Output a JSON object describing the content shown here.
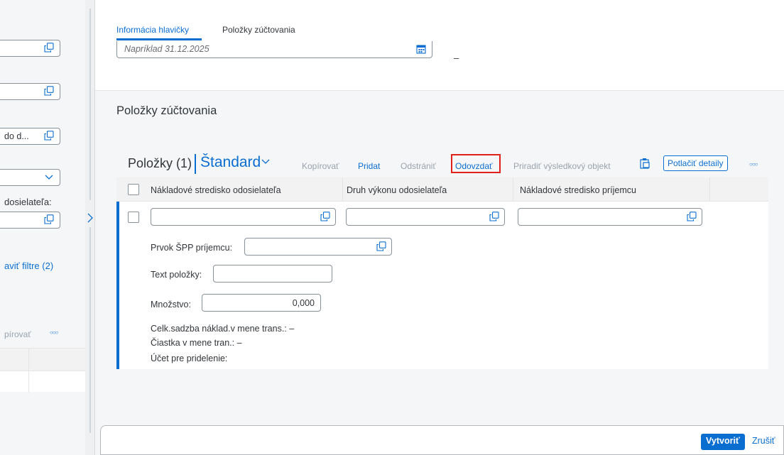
{
  "left_panel": {
    "field3_text": "do d...",
    "field5_label": "dosielateľa:",
    "filters_link": "aviť filtre (2)",
    "copy_label": "pírovať",
    "more_glyph": "○○○"
  },
  "tabs": [
    {
      "label": "Informácia hlavičky"
    },
    {
      "label": "Položky zúčtovania"
    }
  ],
  "header": {
    "date_placeholder": "Napríklad 31.12.2025",
    "dash": "–"
  },
  "section_title": "Položky zúčtovania",
  "toolbar": {
    "title": "Položky (1)",
    "variant": "Štandard",
    "copy": "Kopírovať",
    "add": "Pridat",
    "remove": "Odstrániť",
    "hand_over": "Odovzdať",
    "assign": "Priradiť výsledkový objekt",
    "suppress": "Potlačiť detaily",
    "more": "○○○"
  },
  "table": {
    "columns": [
      "Nákladové stredisko odosielateľa",
      "Druh výkonu odosielateľa",
      "Nákladové stredisko príjemcu"
    ],
    "detail": {
      "wbs_label": "Prvok ŠPP príjemcu:",
      "text_label": "Text položky:",
      "qty_label": "Množstvo:",
      "qty_value": "0,000",
      "rate_label": "Celk.sadzba náklad.v mene trans.: –",
      "amount_label": "Čiastka v mene tran.: –",
      "account_label": "Účet pre pridelenie:"
    }
  },
  "footer": {
    "create": "Vytvoriť",
    "cancel": "Zrušiť"
  },
  "colors": {
    "accent": "#0a6ed1",
    "highlight": "#e0201a"
  }
}
